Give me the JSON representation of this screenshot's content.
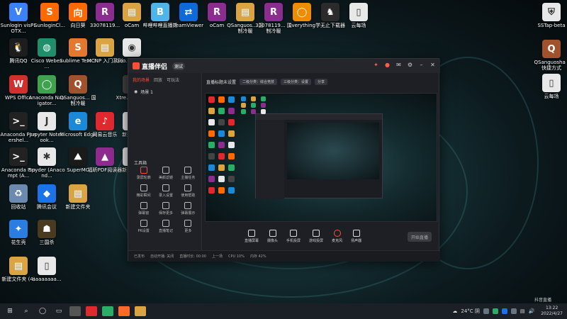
{
  "desktop_icons": [
    {
      "id": "visPLOTX",
      "label": "Sunlogin\nvisPLOTX...",
      "color": "#3b82f6",
      "glyph": "V"
    },
    {
      "id": "sunlogin",
      "label": "SunloginCl...",
      "color": "#ff6a00",
      "glyph": "S"
    },
    {
      "id": "xiangrikui",
      "label": "向日葵",
      "color": "#ff6a00",
      "glyph": "向"
    },
    {
      "id": "rar1",
      "label": "3307811​9...",
      "color": "#8b2d8e",
      "glyph": "R"
    },
    {
      "id": "ocam1",
      "label": "oCam",
      "color": "#d9a441",
      "glyph": "▤"
    },
    {
      "id": "bilibili",
      "label": "哔哩哔哩直播姬",
      "color": "#4fb4e8",
      "glyph": "B"
    },
    {
      "id": "teamviewer",
      "label": "TeamViewer",
      "color": "#0e6ad8",
      "glyph": "⇄"
    },
    {
      "id": "ocam2",
      "label": "oCam",
      "color": "#8b2d8e",
      "glyph": "R"
    },
    {
      "id": "qsanguosha",
      "label": "QSanguos...\n国制冷暖",
      "color": "#d9a441",
      "glyph": "▤"
    },
    {
      "id": "rar2",
      "label": "3307811​9...\n国制冷暖",
      "color": "#8b2d8e",
      "glyph": "R"
    },
    {
      "id": "everything",
      "label": "Everything",
      "color": "#f08c00",
      "glyph": "◯"
    },
    {
      "id": "xuewushang",
      "label": "学无止下载器",
      "color": "#2b2b2b",
      "glyph": "♞"
    },
    {
      "id": "yunzhuofu",
      "label": "云每场",
      "color": "#e8e8e8",
      "glyph": "▯"
    },
    {
      "id": "sstap",
      "label": "SSTap-beta",
      "color": "#e8e8e8",
      "glyph": "⛨"
    },
    {
      "id": "qq",
      "label": "腾讯QQ",
      "color": "#1d1d1d",
      "glyph": "🐧"
    },
    {
      "id": "webex",
      "label": "Cisco Webex ...",
      "color": "#1f8f6b",
      "glyph": "◍"
    },
    {
      "id": "sublime",
      "label": "Sublime Text 3",
      "color": "#e5782f",
      "glyph": "S"
    },
    {
      "id": "mcnp",
      "label": "MCNP 入门系列",
      "color": "#d9a441",
      "glyph": "▤"
    },
    {
      "id": "chrome",
      "label": "Goo...\nChro...",
      "color": "#e8e8e8",
      "glyph": "◉"
    },
    {
      "id": "wps",
      "label": "WPS Office",
      "color": "#d32f2f",
      "glyph": "W"
    },
    {
      "id": "anaconda-nav",
      "label": "Anaconda Navigator...",
      "color": "#3fa34d",
      "glyph": "◯"
    },
    {
      "id": "qsanguosha2",
      "label": "QSanguos...\n国制冷暖",
      "color": "#a0522d",
      "glyph": "Q"
    },
    {
      "id": "xtreme",
      "label": "Xtre...\nDow...",
      "color": "#444",
      "glyph": "X"
    },
    {
      "id": "anaconda-ps",
      "label": "Anaconda Powershel...",
      "color": "#222",
      "glyph": ">_"
    },
    {
      "id": "jupyter",
      "label": "Jupyter Notebook...",
      "color": "#e8e8e8",
      "glyph": "J"
    },
    {
      "id": "edge",
      "label": "Microsoft Edge",
      "color": "#1a8ad8",
      "glyph": "e"
    },
    {
      "id": "netease",
      "label": "网易云音乐",
      "color": "#e0282f",
      "glyph": "♪"
    },
    {
      "id": "newtext",
      "label": "新建文...",
      "color": "#e8e8e8",
      "glyph": "▯"
    },
    {
      "id": "anaconda-prompt",
      "label": "Anaconda Prompt (A...",
      "color": "#222",
      "glyph": ">_"
    },
    {
      "id": "spyder",
      "label": "Spyder (Anacond...",
      "color": "#e8e8e8",
      "glyph": "✱"
    },
    {
      "id": "supermc",
      "label": "SuperMC",
      "color": "#1a1a1a",
      "glyph": "⛰"
    },
    {
      "id": "foxit",
      "label": "福昕PDF阅读器",
      "color": "#8e2b8e",
      "glyph": "▲"
    },
    {
      "id": "newtext2",
      "label": "新建文...",
      "color": "#e8e8e8",
      "glyph": "▯"
    },
    {
      "id": "recycle",
      "label": "回收站",
      "color": "#6c8ab0",
      "glyph": "♻"
    },
    {
      "id": "tencent-meeting",
      "label": "腾讯会议",
      "color": "#1a73e8",
      "glyph": "◆"
    },
    {
      "id": "newfolder",
      "label": "新建文件夹",
      "color": "#d9a441",
      "glyph": "▤"
    },
    {
      "id": "huasheng",
      "label": "花生壳",
      "color": "#2a7de1",
      "glyph": "✦"
    },
    {
      "id": "sanguosha",
      "label": "三国杀",
      "color": "#4a3a20",
      "glyph": "☗"
    },
    {
      "id": "newfolder4",
      "label": "新建文件夹 (4)",
      "color": "#d9a441",
      "glyph": "▤"
    },
    {
      "id": "aaaa",
      "label": "aaaaaaaa...",
      "color": "#e8e8e8",
      "glyph": "▯"
    },
    {
      "id": "qsanguosha-shortcut",
      "label": "QSanguosha - 快捷方式",
      "color": "#a0522d",
      "glyph": "Q"
    },
    {
      "id": "yunzhuofu2",
      "label": "云每场",
      "color": "#e8e8e8",
      "glyph": "▯"
    }
  ],
  "app": {
    "name": "直播伴侣",
    "version": "测试",
    "sidebar_tabs": [
      "我的场景",
      "回放",
      "可玩法"
    ],
    "scene": "场景 1",
    "tools_title": "工具箱",
    "tools": [
      {
        "label": "录屏轮廓",
        "red": true
      },
      {
        "label": "美颜滤镜",
        "red": false
      },
      {
        "label": "主播任务",
        "red": false
      },
      {
        "label": "精彩瞬间",
        "red": false
      },
      {
        "label": "录入设置",
        "red": false
      },
      {
        "label": "使用帮助",
        "red": false
      },
      {
        "label": "弹幕窗",
        "red": false
      },
      {
        "label": "保存更多",
        "red": false
      },
      {
        "label": "弹幕展示",
        "red": false
      },
      {
        "label": "PK设置",
        "red": false
      },
      {
        "label": "直播笔记",
        "red": false
      },
      {
        "label": "更多",
        "red": false
      }
    ],
    "main_title": "直播标题未设置",
    "main_tags": [
      "二级分类：综合竞技",
      "三级分类：设置",
      "分享"
    ],
    "live_controls": [
      "直播屏幕",
      "摄像头",
      "手机投屏",
      "游戏投屏",
      "麦克风",
      "扬声器"
    ],
    "start_label": "开始直播",
    "status_items": [
      "已发布",
      "自动开播: 关闭",
      "直播时长: 00:00",
      "上一场",
      "CPU 10%",
      "内存 42%"
    ]
  },
  "taskbar": {
    "weather": "24°C 阴",
    "time": "13:22",
    "date": "2022/4/27"
  },
  "watermark": "抖音直播"
}
